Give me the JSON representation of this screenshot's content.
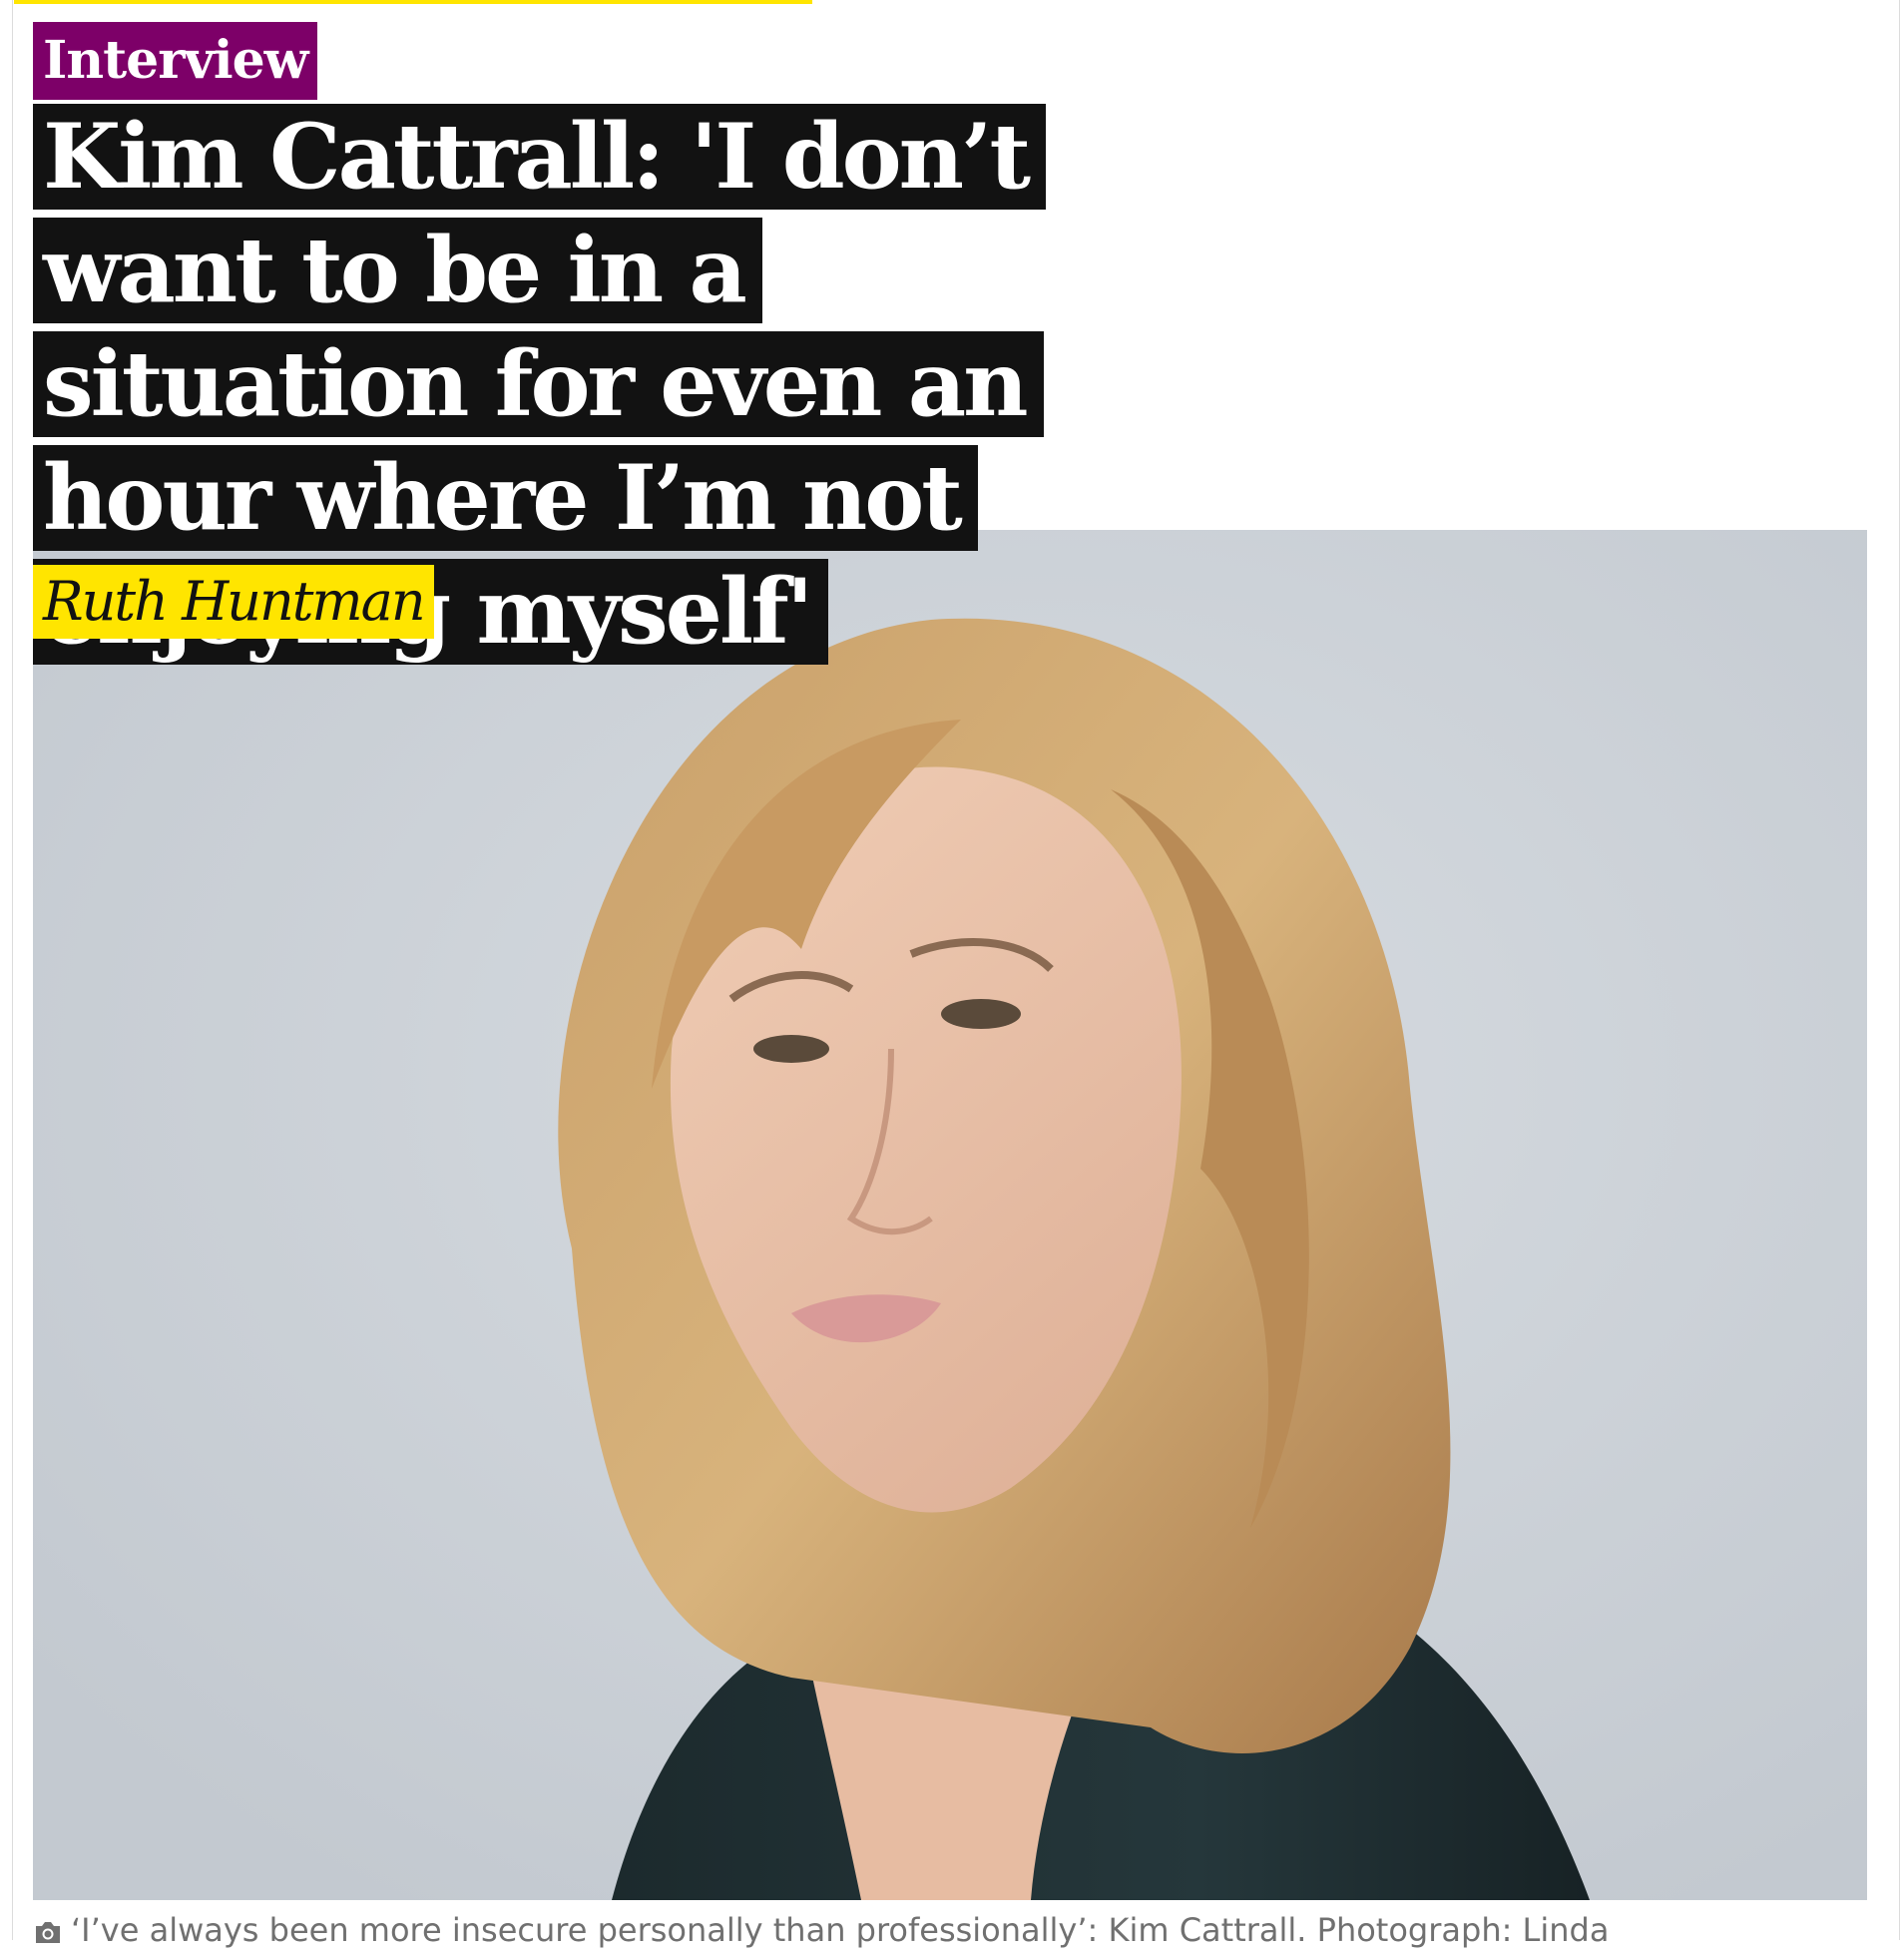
{
  "article": {
    "kicker": "Interview",
    "headline": "Kim Cattrall: 'I don’t want to be in a situation for even an hour where I’m not enjoying myself'",
    "byline": "Ruth Huntman",
    "image": {
      "alt": "Kim Cattrall",
      "caption": "‘I’ve always been more insecure personally than professionally’: Kim Cattrall. Photograph: Linda"
    }
  },
  "colors": {
    "kicker_bg": "#7d0068",
    "headline_bg": "#121212",
    "byline_bg": "#ffe500",
    "accent_bar": "#ffe500"
  },
  "icons": {
    "caption": "camera-icon"
  }
}
